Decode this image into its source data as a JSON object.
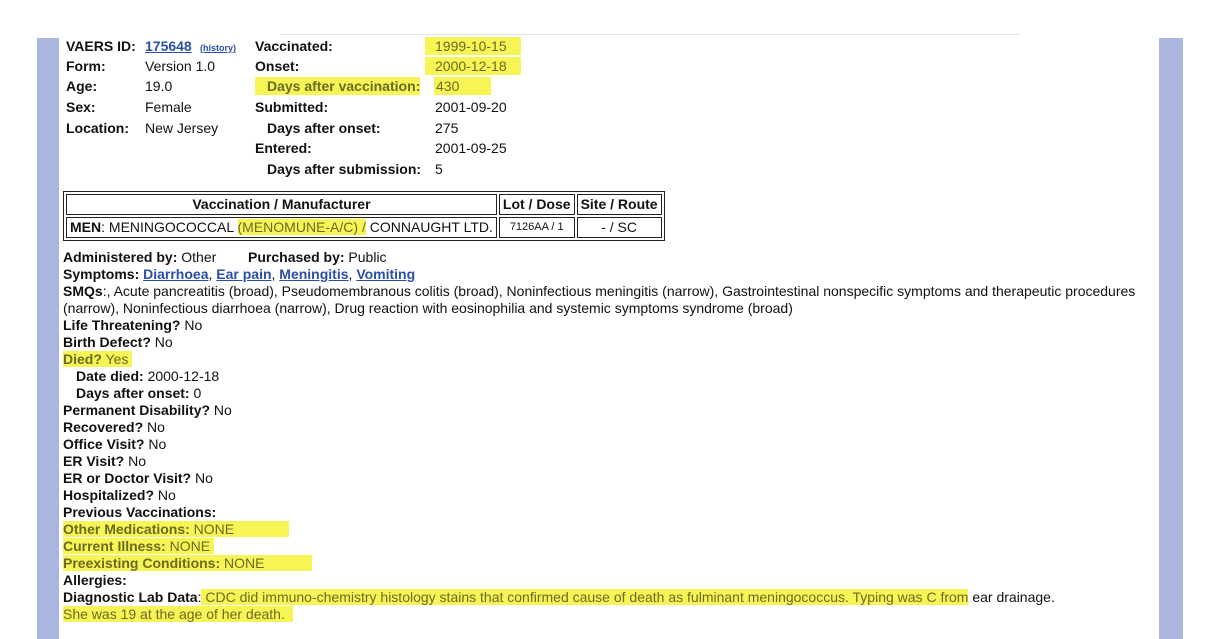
{
  "record": {
    "vaers_id_label": "VAERS ID:",
    "vaers_id": "175648",
    "history_link": "(history)",
    "form_label": "Form:",
    "form": "Version 1.0",
    "age_label": "Age:",
    "age": "19.0",
    "sex_label": "Sex:",
    "sex": "Female",
    "location_label": "Location:",
    "location": "New Jersey",
    "vaccinated_label": "Vaccinated:",
    "vaccinated": "1999-10-15",
    "onset_label": "Onset:",
    "onset": "2000-12-18",
    "days_after_vax_label": "Days after vaccination:",
    "days_after_vax": "430",
    "submitted_label": "Submitted:",
    "submitted": "2001-09-20",
    "days_after_onset_label": "Days after onset:",
    "days_after_onset": "275",
    "entered_label": "Entered:",
    "entered": "2001-09-25",
    "days_after_submission_label": "Days after submission:",
    "days_after_submission": "5"
  },
  "vaccine_table": {
    "headers": [
      "Vaccination / Manufacturer",
      "Lot / Dose",
      "Site / Route"
    ],
    "row": {
      "code": "MEN",
      "name": ": MENINGOCOCCAL ",
      "brand": "(MENOMUNE-A/C) /",
      "manufacturer": " CONNAUGHT LTD.",
      "lot_dose": "7126AA / 1",
      "site_route": "- / SC"
    }
  },
  "details": {
    "administered_label": "Administered by:",
    "administered": " Other",
    "purchased_label": "Purchased by:",
    "purchased": " Public",
    "symptoms_label": "Symptoms:",
    "symptoms": [
      "Diarrhoea",
      "Ear pain",
      "Meningitis",
      "Vomiting"
    ],
    "smqs_label": "SMQs",
    "smqs": ":, Acute pancreatitis (broad), Pseudomembranous colitis (broad), Noninfectious meningitis (narrow), Gastrointestinal nonspecific symptoms and therapeutic procedures (narrow), Noninfectious diarrhoea (narrow), Drug reaction with eosinophilia and systemic symptoms syndrome (broad)",
    "life_threatening_label": "Life Threatening?",
    "life_threatening": " No",
    "birth_defect_label": "Birth Defect?",
    "birth_defect": " No",
    "died_label": "Died?",
    "died": " Yes",
    "date_died_label": "Date died:",
    "date_died": " 2000-12-18",
    "died_days_after_onset_label": "Days after onset:",
    "died_days_after_onset": " 0",
    "disability_label": "Permanent Disability?",
    "disability": " No",
    "recovered_label": "Recovered?",
    "recovered": " No",
    "office_visit_label": "Office Visit?",
    "office_visit": " No",
    "er_visit_label": "ER Visit?",
    "er_visit": " No",
    "er_doctor_label": "ER or Doctor Visit?",
    "er_doctor": " No",
    "hospitalized_label": "Hospitalized?",
    "hospitalized": " No",
    "prev_vax_label": "Previous Vaccinations:",
    "other_meds_label": "Other Medications:",
    "other_meds": " NONE",
    "current_illness_label": "Current Illness:",
    "current_illness": " NONE",
    "preexisting_label": "Preexisting Conditions:",
    "preexisting": " NONE",
    "allergies_label": "Allergies:",
    "lab_label": "Diagnostic Lab Data",
    "lab_colon": ":",
    "lab_hl": " CDC did immuno-chemistry histology stains that confirmed cause of death as fulminant meningococcus. Typing was C from",
    "lab_rest": " ear drainage.",
    "lab_line2": "She was 19 at the age of her death."
  },
  "colors": {
    "highlight": "#f7f455",
    "link": "#2a4fa7",
    "side_bar": "#aab6df"
  }
}
